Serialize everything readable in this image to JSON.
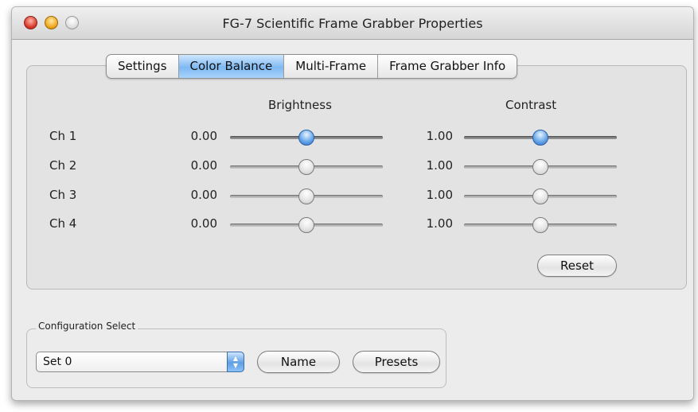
{
  "window": {
    "title": "FG-7 Scientific Frame Grabber Properties"
  },
  "tabs": [
    {
      "label": "Settings",
      "active": false
    },
    {
      "label": "Color Balance",
      "active": true
    },
    {
      "label": "Multi-Frame",
      "active": false
    },
    {
      "label": "Frame Grabber Info",
      "active": false
    }
  ],
  "color_balance": {
    "brightness_header": "Brightness",
    "contrast_header": "Contrast",
    "channels": [
      {
        "label": "Ch 1",
        "brightness": "0.00",
        "brightness_level": 0.5,
        "contrast": "1.00",
        "contrast_level": 0.5
      },
      {
        "label": "Ch 2",
        "brightness": "0.00",
        "brightness_level": 0.5,
        "contrast": "1.00",
        "contrast_level": 0.5
      },
      {
        "label": "Ch 3",
        "brightness": "0.00",
        "brightness_level": 0.5,
        "contrast": "1.00",
        "contrast_level": 0.5
      },
      {
        "label": "Ch 4",
        "brightness": "0.00",
        "brightness_level": 0.5,
        "contrast": "1.00",
        "contrast_level": 0.5
      }
    ],
    "reset_label": "Reset"
  },
  "configuration": {
    "group_label": "Configuration Select",
    "selected": "Set 0",
    "name_label": "Name",
    "presets_label": "Presets"
  },
  "colors": {
    "accent": "#6aa8ea",
    "window_bg": "#ececec"
  }
}
